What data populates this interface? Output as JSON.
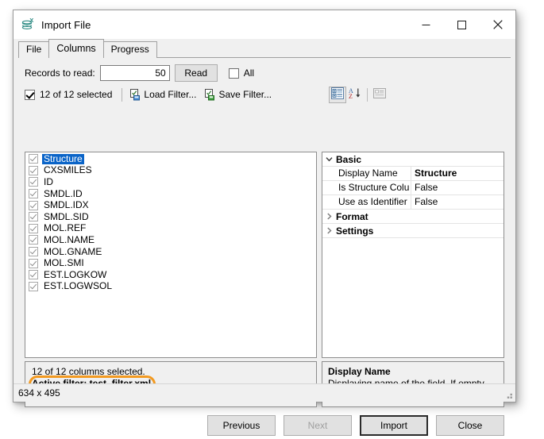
{
  "window": {
    "title": "Import File",
    "icon": "stacked-disks-x-icon",
    "controls": {
      "minimize": "minimize-icon",
      "maximize": "maximize-icon",
      "close": "close-icon"
    }
  },
  "tabs": [
    {
      "label": "File",
      "active": false
    },
    {
      "label": "Columns",
      "active": true
    },
    {
      "label": "Progress",
      "active": false
    }
  ],
  "toolbar": {
    "records_label": "Records to read:",
    "records_value": "50",
    "records_placeholder": "",
    "read_label": "Read",
    "all_label": "All",
    "all_checked": false,
    "selected_label": "12 of 12 selected",
    "selected_checked": true,
    "load_filter_label": "Load Filter...",
    "save_filter_label": "Save Filter..."
  },
  "property_toolbar": {
    "categorized_icon": "categorized-view-icon",
    "alphabetical_icon": "sort-alphabetical-icon",
    "property_pages_icon": "property-pages-icon"
  },
  "columns": [
    {
      "label": "Structure",
      "checked": true,
      "selected": true
    },
    {
      "label": "CXSMILES",
      "checked": true,
      "selected": false
    },
    {
      "label": "ID",
      "checked": true,
      "selected": false
    },
    {
      "label": "SMDL.ID",
      "checked": true,
      "selected": false
    },
    {
      "label": "SMDL.IDX",
      "checked": true,
      "selected": false
    },
    {
      "label": "SMDL.SID",
      "checked": true,
      "selected": false
    },
    {
      "label": "MOL.REF",
      "checked": true,
      "selected": false
    },
    {
      "label": "MOL.NAME",
      "checked": true,
      "selected": false
    },
    {
      "label": "MOL.GNAME",
      "checked": true,
      "selected": false
    },
    {
      "label": "MOL.SMI",
      "checked": true,
      "selected": false
    },
    {
      "label": "EST.LOGKOW",
      "checked": true,
      "selected": false
    },
    {
      "label": "EST.LOGWSOL",
      "checked": true,
      "selected": false
    }
  ],
  "property_grid": [
    {
      "type": "category",
      "name": "Basic",
      "expanded": true,
      "rows": [
        {
          "name": "Display Name",
          "value": "Structure",
          "bold": true
        },
        {
          "name": "Is Structure Colu",
          "value": "False",
          "bold": false
        },
        {
          "name": "Use as Identifier",
          "value": "False",
          "bold": false
        }
      ]
    },
    {
      "type": "category",
      "name": "Format",
      "expanded": false,
      "rows": []
    },
    {
      "type": "category",
      "name": "Settings",
      "expanded": false,
      "rows": []
    }
  ],
  "status_pane": {
    "line1": "12 of 12 columns selected.",
    "line2": "Active filter: test_filter.xml",
    "highlight_color": "#f29a21"
  },
  "description_pane": {
    "title": "Display Name",
    "body": "Displaying name of the field. If empty, the ID will be used."
  },
  "buttons": [
    {
      "label": "Previous",
      "disabled": false,
      "default": false
    },
    {
      "label": "Next",
      "disabled": true,
      "default": false
    },
    {
      "label": "Import",
      "disabled": false,
      "default": true
    },
    {
      "label": "Close",
      "disabled": false,
      "default": false
    }
  ],
  "statusbar": {
    "text": "634 x 495",
    "grip": "resize-grip-icon"
  },
  "colors": {
    "selection_blue": "#0a64c8",
    "accent_orange": "#f29a21",
    "window_face": "#f0f0f0",
    "icon_teal": "#2e8b84"
  }
}
